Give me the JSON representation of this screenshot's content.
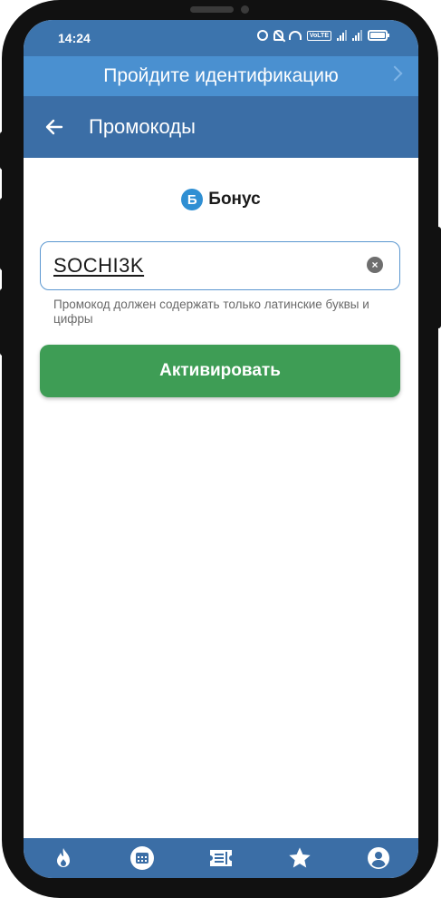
{
  "status_bar": {
    "time": "14:24",
    "volte_label": "VoLTE"
  },
  "banner": {
    "text": "Пройдите идентификацию"
  },
  "app_bar": {
    "title": "Промокоды"
  },
  "brand": {
    "logo_letter": "Б",
    "name": "Бонус"
  },
  "promo": {
    "value": "SOCHI3K",
    "hint": "Промокод должен содержать только латинские буквы и цифры",
    "clear_symbol": "×"
  },
  "activate_button": {
    "label": "Активировать"
  },
  "bottom_nav": {
    "items": [
      {
        "icon": "flame-icon"
      },
      {
        "icon": "calendar-icon"
      },
      {
        "icon": "ticket-icon"
      },
      {
        "icon": "star-icon"
      },
      {
        "icon": "profile-icon"
      }
    ]
  },
  "colors": {
    "status_bar": "#3c74ad",
    "banner": "#4a90d0",
    "app_bar": "#3b6ea6",
    "accent_green": "#3e9d55",
    "field_border": "#5b97d0",
    "brand_blue": "#2f8fd3"
  }
}
